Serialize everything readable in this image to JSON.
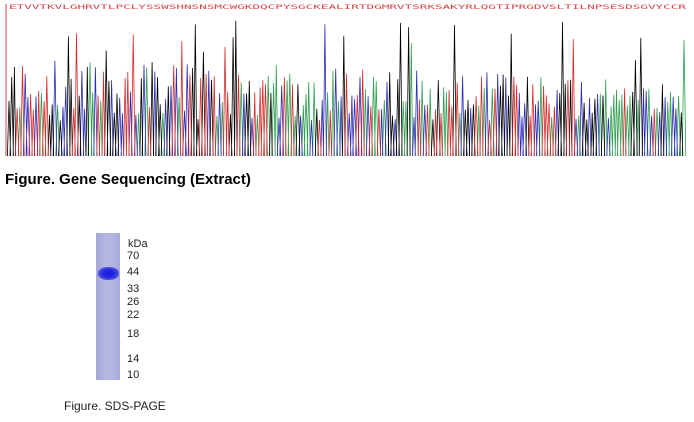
{
  "sequencing": {
    "sequence": "ETVVTKVLGHRVTLPCLYSSWSHNSNSMCWGKDQCPYSGCKEALIRTDGMRVTSRKSAKYRLQGTIPRGDVSLTILNPSESDSGVYCCR",
    "caption": "Figure. Gene Sequencing (Extract)",
    "colors": {
      "letters": "#d64545",
      "trace_a": "#2e9e4f",
      "trace_c": "#2a2ab8",
      "trace_g": "#000000",
      "trace_t": "#d62a2a"
    }
  },
  "gel": {
    "unit_label": "kDa",
    "markers": [
      "70",
      "44",
      "33",
      "26",
      "22",
      "18",
      "14",
      "10"
    ],
    "caption": "Figure. SDS-PAGE",
    "colors": {
      "lane": "#b0b3e0",
      "band": "#1c1ce0"
    }
  }
}
